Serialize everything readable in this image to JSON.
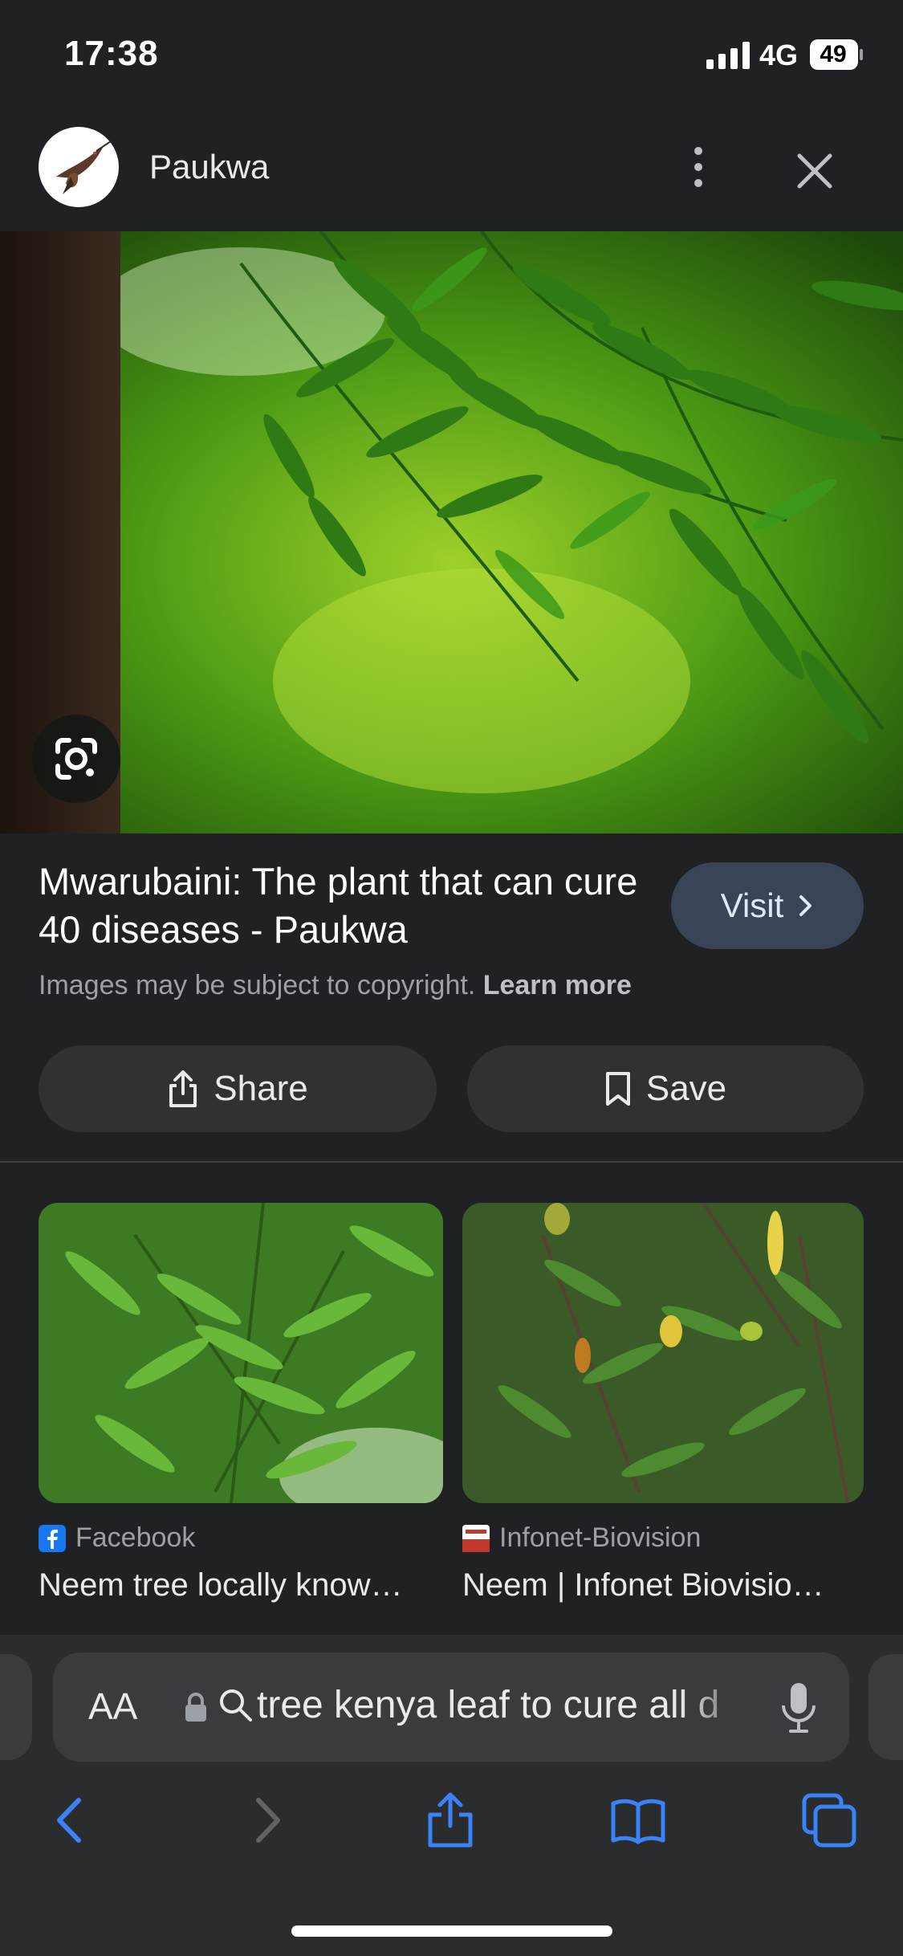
{
  "status_bar": {
    "time": "17:38",
    "network": "4G",
    "battery": "49"
  },
  "header": {
    "site_name": "Paukwa"
  },
  "result": {
    "title": "Mwarubaini: The plant that can cure 40 diseases - Paukwa",
    "visit_label": "Visit",
    "copyright_text": "Images may be subject to copyright.",
    "learn_more": "Learn more",
    "share_label": "Share",
    "save_label": "Save"
  },
  "related": [
    {
      "source": "Facebook",
      "caption": "Neem tree locally know…"
    },
    {
      "source": "Infonet-Biovision",
      "caption": "Neem | Infonet Biovisio…"
    }
  ],
  "safari": {
    "aa_label": "AA",
    "address_text": "tree kenya leaf to cure all d"
  },
  "colors": {
    "background": "#202124",
    "visit_button": "#394457",
    "ios_blue": "#3b82f6"
  }
}
